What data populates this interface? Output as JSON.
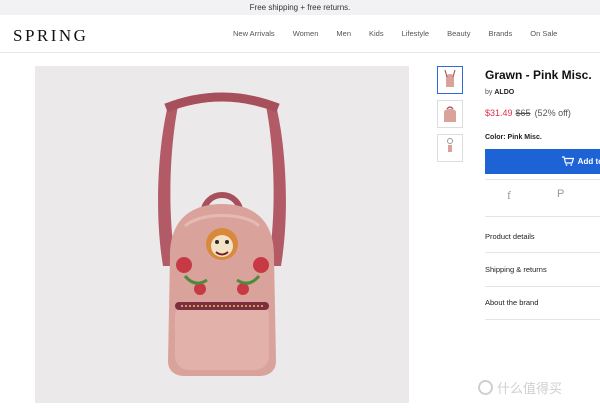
{
  "banner": {
    "text": "Free shipping + free returns."
  },
  "header": {
    "logo": "SPRING",
    "nav": [
      "New Arrivals",
      "Women",
      "Men",
      "Kids",
      "Lifestyle",
      "Beauty",
      "Brands",
      "On Sale"
    ]
  },
  "product": {
    "title": "Grawn - Pink Misc.",
    "brand_prefix": "by",
    "brand": "ALDO",
    "sale_price": "$31.49",
    "original_price": "$65",
    "discount": "(52% off)",
    "color_label": "Color: Pink Misc.",
    "add_button": "Add to"
  },
  "social": {
    "facebook_glyph": "f",
    "pinterest_glyph": "P"
  },
  "accordion": [
    "Product details",
    "Shipping & returns",
    "About the brand"
  ],
  "watermark": {
    "text": "什么值得买"
  },
  "colors": {
    "accent": "#1e63d6",
    "sale": "#e0314b",
    "bag_pink": "#d9a39c"
  }
}
